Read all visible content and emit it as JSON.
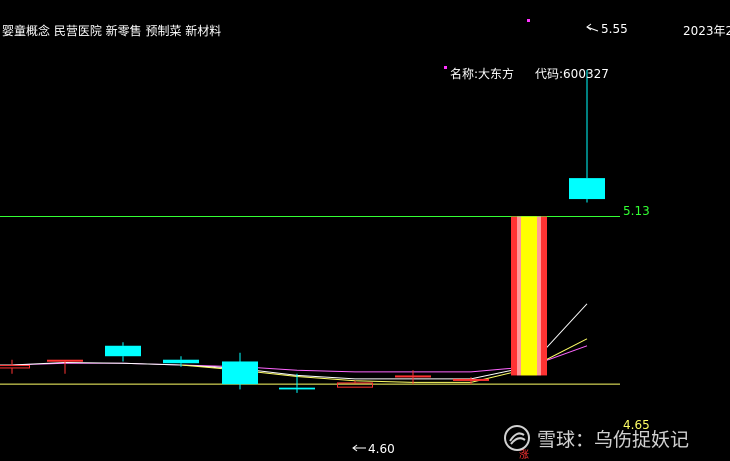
{
  "header": {
    "concepts": "婴童概念 民营医院 新零售 预制菜 新材料",
    "date_label": "2023年2",
    "stock_name": "名称:大东方",
    "stock_code": "代码:600327"
  },
  "chart_data": {
    "type": "candlestick",
    "y_range": [
      4.43,
      5.75
    ],
    "reference_lines": [
      {
        "label": "5.13",
        "value": 5.13,
        "color": "#33ff33"
      },
      {
        "label": "4.65",
        "value": 4.65,
        "color": "#ffff66"
      }
    ],
    "annotations": {
      "high_label": "5.55",
      "low_label": "4.60"
    },
    "candles": [
      {
        "open": 4.695,
        "close": 4.705,
        "high": 4.72,
        "low": 4.68,
        "up": true
      },
      {
        "open": 4.715,
        "close": 4.72,
        "high": 4.72,
        "low": 4.68,
        "up": true
      },
      {
        "open": 4.73,
        "close": 4.76,
        "high": 4.77,
        "low": 4.715,
        "up": false
      },
      {
        "open": 4.71,
        "close": 4.72,
        "high": 4.73,
        "low": 4.7,
        "up": false
      },
      {
        "open": 4.715,
        "close": 4.65,
        "high": 4.74,
        "low": 4.635,
        "up": false
      },
      {
        "open": 4.64,
        "close": 4.635,
        "high": 4.68,
        "low": 4.625,
        "up": false
      },
      {
        "open": 4.64,
        "close": 4.655,
        "high": 4.66,
        "low": 4.64,
        "up": true
      },
      {
        "open": 4.67,
        "close": 4.675,
        "high": 4.69,
        "low": 4.65,
        "up": true
      },
      {
        "open": 4.66,
        "close": 4.665,
        "high": 4.67,
        "low": 4.65,
        "up": true
      },
      {
        "open": 4.675,
        "close": 5.13,
        "high": 5.13,
        "low": 4.675,
        "up": true,
        "limit_up": true
      },
      {
        "open": 5.18,
        "close": 5.24,
        "high": 5.55,
        "low": 5.17,
        "up": false
      }
    ],
    "moving_averages": [
      {
        "color": "#ff66ff",
        "values": [
          4.705,
          4.71,
          4.71,
          4.705,
          4.7,
          4.69,
          4.685,
          4.685,
          4.685,
          4.7,
          4.76
        ]
      },
      {
        "color": "#ffffff",
        "values": [
          4.705,
          4.712,
          4.71,
          4.705,
          4.695,
          4.675,
          4.665,
          4.665,
          4.665,
          4.7,
          4.88
        ]
      },
      {
        "color": "#ffff66",
        "values": [
          null,
          null,
          null,
          4.705,
          4.69,
          4.672,
          4.66,
          4.655,
          4.655,
          4.695,
          4.78
        ]
      }
    ],
    "colors": {
      "up": "#ff3333",
      "down": "#00ffff",
      "limit_outer": "#ff3333",
      "limit_mid": "#ff9999",
      "limit_inner": "#ffff00"
    }
  },
  "markers": {
    "bottom_symbol": "涨"
  },
  "watermark": {
    "icon": "snowball-logo-icon",
    "text": "雪球：乌伤捉妖记"
  }
}
